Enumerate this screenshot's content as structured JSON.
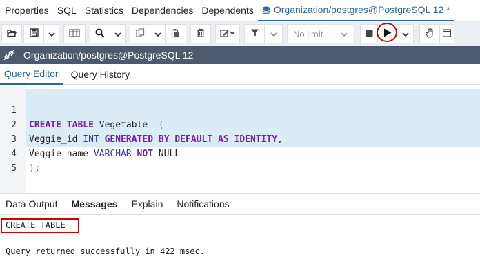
{
  "top_tabs": [
    {
      "label": "Properties"
    },
    {
      "label": "SQL"
    },
    {
      "label": "Statistics"
    },
    {
      "label": "Dependencies"
    },
    {
      "label": "Dependents"
    },
    {
      "label": "Organization/postgres@PostgreSQL 12 *",
      "active": true,
      "icon": "database-icon"
    }
  ],
  "toolbar": {
    "limit_label": "No limit",
    "icons": [
      "open-folder-icon",
      "save-icon",
      "chevron-down-icon",
      "table-view-icon",
      "search-icon",
      "chevron-down-icon",
      "copy-icon",
      "chevron-down-icon",
      "paste-icon",
      "trash-icon",
      "edit-icon",
      "filter-icon",
      "chevron-down-icon",
      "stop-icon",
      "play-icon",
      "chevron-down-icon",
      "hand-icon",
      "scratch-icon"
    ]
  },
  "connection": {
    "title": "Organization/postgres@PostgreSQL 12",
    "icon": "link-icon"
  },
  "query_tabs": [
    {
      "label": "Query Editor",
      "active": true
    },
    {
      "label": "Query History"
    }
  ],
  "editor": {
    "line_numbers": [
      "1",
      "2",
      "3",
      "4",
      "5"
    ]
  },
  "result_tabs": [
    {
      "label": "Data Output"
    },
    {
      "label": "Messages",
      "active": true
    },
    {
      "label": "Explain"
    },
    {
      "label": "Notifications"
    }
  ],
  "messages": {
    "line1": "CREATE TABLE",
    "line2": "Query returned successfully in 422 msec."
  },
  "colors": {
    "accent": "#326690",
    "conn_bar": "#4b5a6e",
    "highlight": "#d10000",
    "selection": "#dbecf7"
  }
}
